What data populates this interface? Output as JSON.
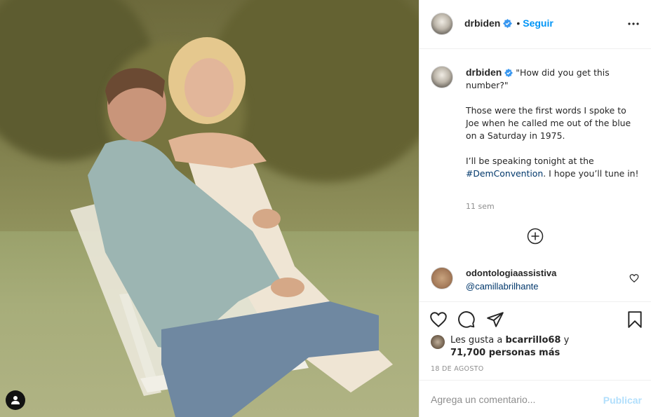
{
  "post": {
    "author": "drbiden",
    "follow_label": "Seguir",
    "dot": "•",
    "caption": {
      "line1": "\"How did you get this number?\"",
      "para2": "Those were the first words I spoke to Joe when he called me out of the blue on a Saturday in 1975.",
      "para3_before": "I’ll be speaking tonight at the ",
      "hashtag": "#DemConvention",
      "para3_after": ". I hope you’ll tune in!"
    },
    "time_ago": "11 sem"
  },
  "comment": {
    "user": "odontologiaassistiva",
    "mention": "@camillabrilhante"
  },
  "likes": {
    "prefix": "Les gusta a ",
    "user": "bcarrillo68",
    "suffix": " y",
    "others": "71,700 personas más"
  },
  "date": "18 DE AGOSTO",
  "add_comment": {
    "placeholder": "Agrega un comentario...",
    "publish_label": "Publicar"
  },
  "colors": {
    "accent": "#0095f6",
    "link": "#00376b",
    "muted": "#8e8e8e",
    "publish_disabled": "#b2dffc"
  },
  "icons": [
    "more-options-icon",
    "verified-badge-icon",
    "load-more-comments-icon",
    "heart-icon",
    "comment-icon",
    "share-icon",
    "save-icon",
    "tag-user-icon"
  ]
}
